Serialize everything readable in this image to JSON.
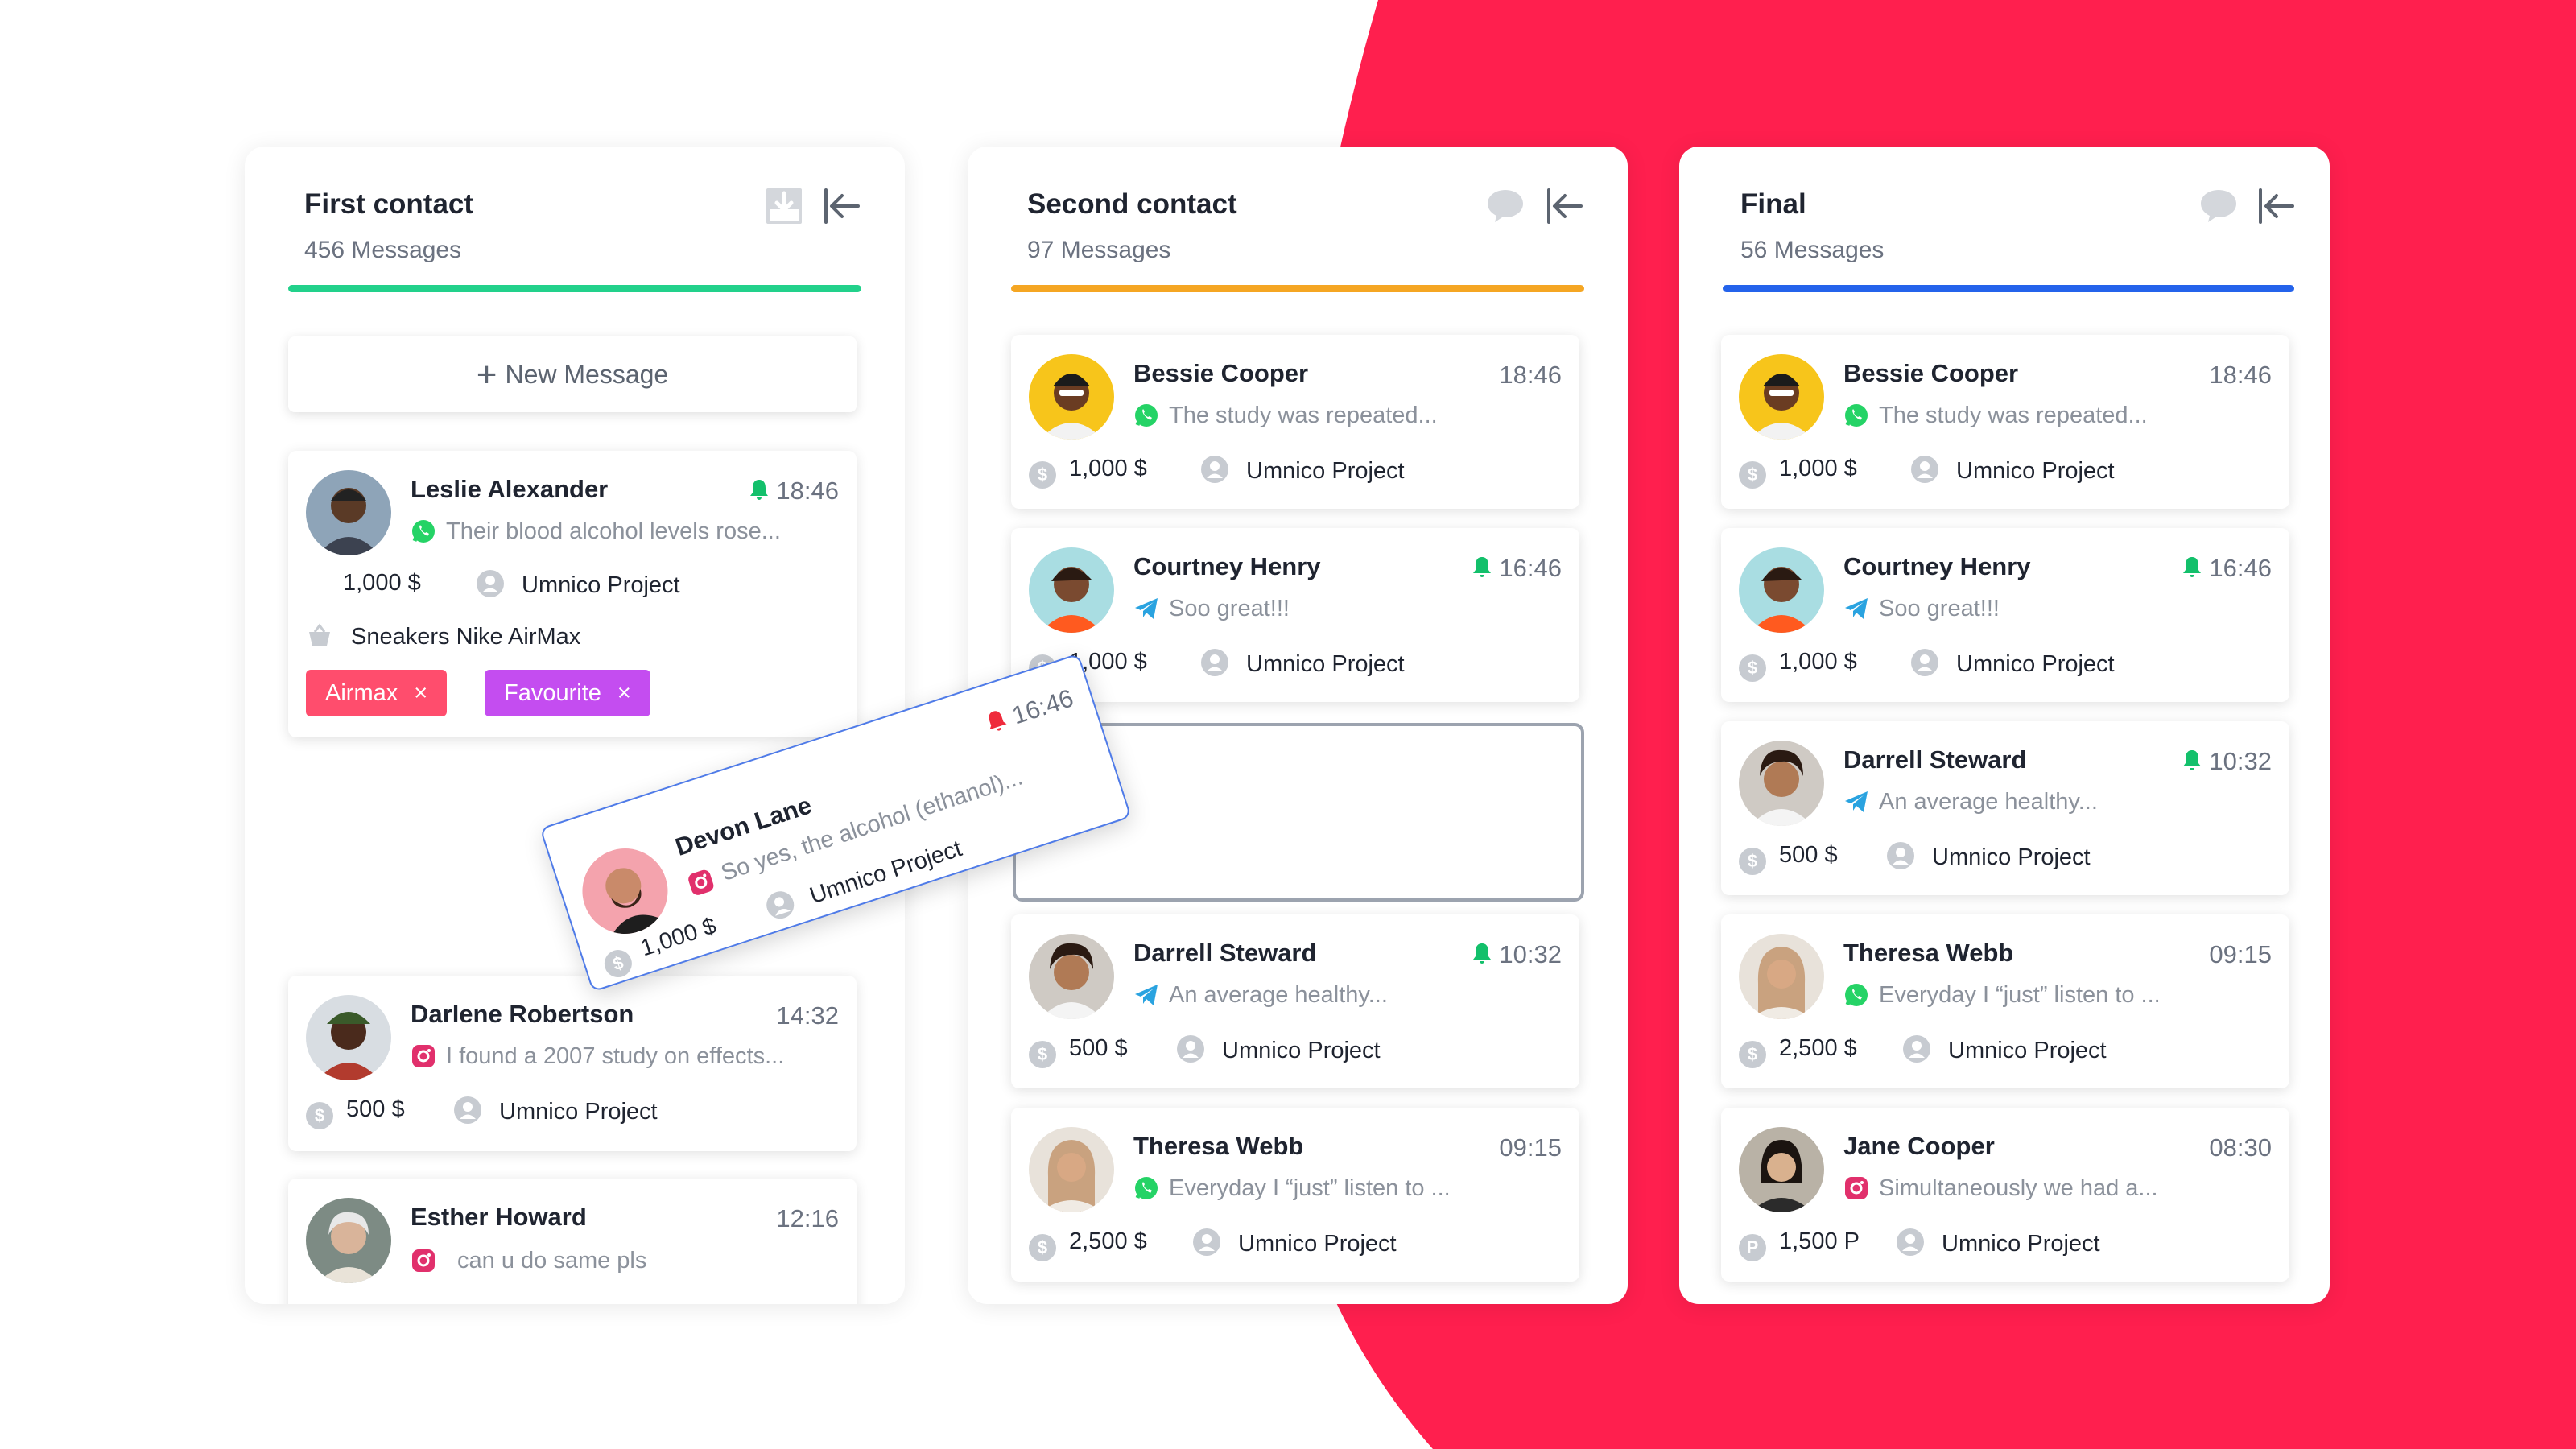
{
  "colors": {
    "accent_red": "#ff1f4e",
    "green": "#22d18b",
    "orange": "#f5a623",
    "blue": "#2463eb",
    "whatsapp": "#25d366",
    "telegram": "#2aa3e0",
    "bell_green": "#13c06b",
    "bell_red": "#ef2b3c"
  },
  "columns": [
    {
      "title": "First contact",
      "count": "456 Messages",
      "bar_color": "#22d18b",
      "icons": [
        "download-icon",
        "collapse-icon"
      ],
      "new_message": "New Message",
      "cards": [
        {
          "name": "Leslie Alexander",
          "time": "18:46",
          "bell": true,
          "channel": "whatsapp",
          "message": "Their blood alcohol levels rose...",
          "amount": "1,000 $",
          "project": "Umnico Project",
          "product": "Sneakers Nike AirMax",
          "tags": [
            {
              "label": "Airmax",
              "color": "#ff4d6d"
            },
            {
              "label": "Favourite",
              "color": "#c44df0"
            }
          ]
        },
        {
          "name": "Darlene Robertson",
          "time": "14:32",
          "bell": false,
          "channel": "instagram",
          "message": "I found a 2007 study on effects...",
          "amount": "500 $",
          "project": "Umnico Project"
        },
        {
          "name": "Esther Howard",
          "time": "12:16",
          "bell": false,
          "channel": "instagram",
          "message": "can u do same pls"
        }
      ]
    },
    {
      "title": "Second contact",
      "count": "97 Messages",
      "bar_color": "#f5a623",
      "icons": [
        "chat-bubble-icon",
        "collapse-icon"
      ],
      "cards": [
        {
          "name": "Bessie Cooper",
          "time": "18:46",
          "bell": false,
          "channel": "whatsapp",
          "message": "The study was repeated...",
          "amount": "1,000 $",
          "project": "Umnico Project"
        },
        {
          "name": "Courtney Henry",
          "time": "16:46",
          "bell": true,
          "channel": "telegram",
          "message": "Soo great!!!",
          "amount": "1,000 $",
          "project": "Umnico Project"
        },
        {
          "name": "Darrell Steward",
          "time": "10:32",
          "bell": true,
          "channel": "telegram",
          "message": "An average healthy...",
          "amount": "500 $",
          "project": "Umnico Project"
        },
        {
          "name": "Theresa Webb",
          "time": "09:15",
          "bell": false,
          "channel": "whatsapp",
          "message": "Everyday I “just” listen to ...",
          "amount": "2,500 $",
          "project": "Umnico Project"
        }
      ]
    },
    {
      "title": "Final",
      "count": "56 Messages",
      "bar_color": "#2463eb",
      "icons": [
        "chat-bubble-icon",
        "collapse-icon"
      ],
      "cards": [
        {
          "name": "Bessie Cooper",
          "time": "18:46",
          "bell": false,
          "channel": "whatsapp",
          "message": "The study was repeated...",
          "amount": "1,000 $",
          "project": "Umnico Project"
        },
        {
          "name": "Courtney Henry",
          "time": "16:46",
          "bell": true,
          "channel": "telegram",
          "message": "Soo great!!!",
          "amount": "1,000 $",
          "project": "Umnico Project"
        },
        {
          "name": "Darrell Steward",
          "time": "10:32",
          "bell": true,
          "channel": "telegram",
          "message": "An average healthy...",
          "amount": "500 $",
          "project": "Umnico Project"
        },
        {
          "name": "Theresa Webb",
          "time": "09:15",
          "bell": false,
          "channel": "whatsapp",
          "message": "Everyday I “just” listen to ...",
          "amount": "2,500 $",
          "project": "Umnico Project"
        },
        {
          "name": "Jane Cooper",
          "time": "08:30",
          "bell": false,
          "channel": "instagram",
          "message": "Simultaneously we had a...",
          "amount": "1,500 P",
          "currency_symbol": "P",
          "project": "Umnico Project"
        }
      ]
    }
  ],
  "dragging_card": {
    "name": "Devon Lane",
    "time": "16:46",
    "bell": true,
    "channel": "instagram",
    "message": "So yes, the alcohol (ethanol)...",
    "amount": "1,000 $",
    "project": "Umnico Project"
  },
  "currency_symbol": "$"
}
